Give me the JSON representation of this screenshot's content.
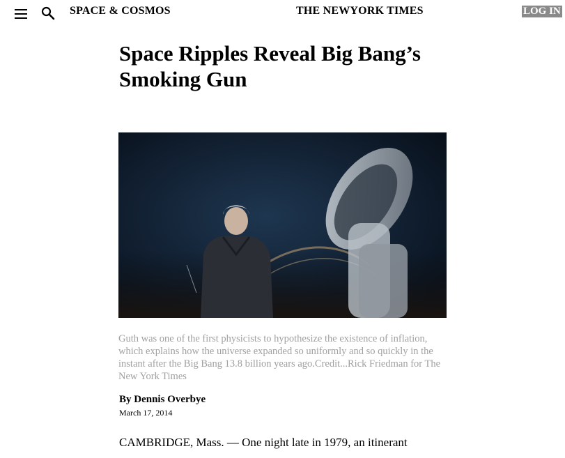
{
  "header": {
    "section_label": "SPACE & COSMOS",
    "masthead": "THE NEWYORK TIMES",
    "login_label": "LOG IN",
    "menu_icon": "hamburger-menu-icon",
    "search_icon": "search-icon"
  },
  "article": {
    "headline": "Space Ripples Reveal Big Bang’s Smoking Gun",
    "caption": "Guth was one of the first physicists to hypothesize the existence of inflation, which explains how the universe expanded so uniformly and so quickly in the instant after the Big Bang 13.8 billion years ago.Credit...Rick Friedman for The New York Times",
    "byline": "By Dennis Overbye",
    "date": "March 17, 2014",
    "body_first_line": "CAMBRIDGE, Mass. — One night late in 1979, an itinerant"
  },
  "colors": {
    "caption_text": "#a0a0a0",
    "login_bg": "#8a8a8a",
    "photo_sky": "#0b1420"
  }
}
